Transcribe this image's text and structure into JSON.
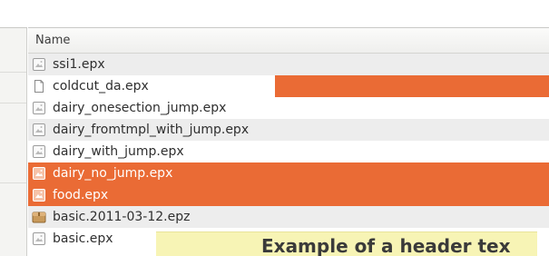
{
  "file_list": {
    "column_header": "Name",
    "rows": [
      {
        "name": "ssi1.epx",
        "icon": "document-image-icon"
      },
      {
        "name": "coldcut_da.epx",
        "icon": "blank-document-icon"
      },
      {
        "name": "dairy_onesection_jump.epx",
        "icon": "document-image-icon"
      },
      {
        "name": "dairy_fromtmpl_with_jump.epx",
        "icon": "document-image-icon"
      },
      {
        "name": "dairy_with_jump.epx",
        "icon": "document-image-icon"
      },
      {
        "name": "dairy_no_jump.epx",
        "icon": "document-image-icon",
        "selected": true
      },
      {
        "name": "food.epx",
        "icon": "document-image-icon",
        "selected": true
      },
      {
        "name": "basic.2011-03-12.epz",
        "icon": "archive-icon"
      },
      {
        "name": "basic.epx",
        "icon": "document-image-icon"
      }
    ]
  },
  "tooltip": {
    "text": "Example of a header tex"
  },
  "colors": {
    "selection": "#ea6b35",
    "alt_row": "#ededed",
    "tooltip_bg": "#f7f4b5"
  }
}
